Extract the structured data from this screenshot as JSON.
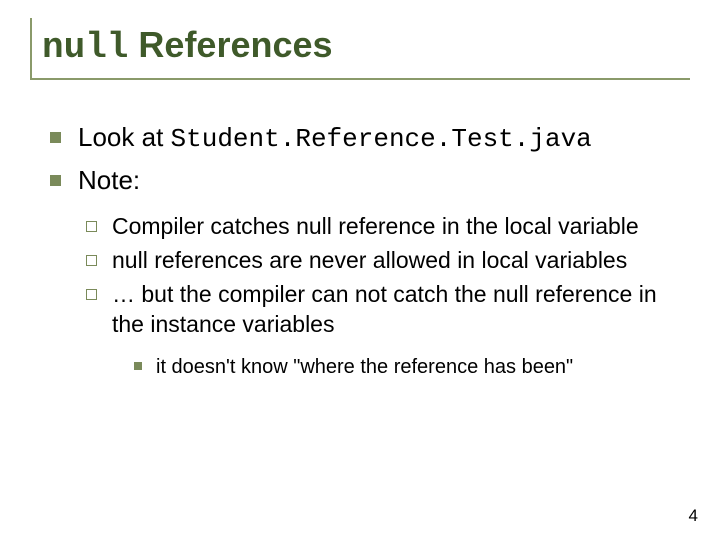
{
  "title": {
    "part_mono": "null",
    "part_rest": " References"
  },
  "bullets": [
    {
      "prefix": "Look at ",
      "code": "Student.Reference.Test.java"
    },
    {
      "text": "Note:"
    }
  ],
  "sub_bullets": [
    "Compiler catches null reference in the local variable",
    "null references are never allowed in local variables",
    "… but the compiler can not catch the null reference in the instance variables"
  ],
  "sub_sub_bullets": [
    "it doesn't know \"where the reference has been\""
  ],
  "page_number": "4"
}
